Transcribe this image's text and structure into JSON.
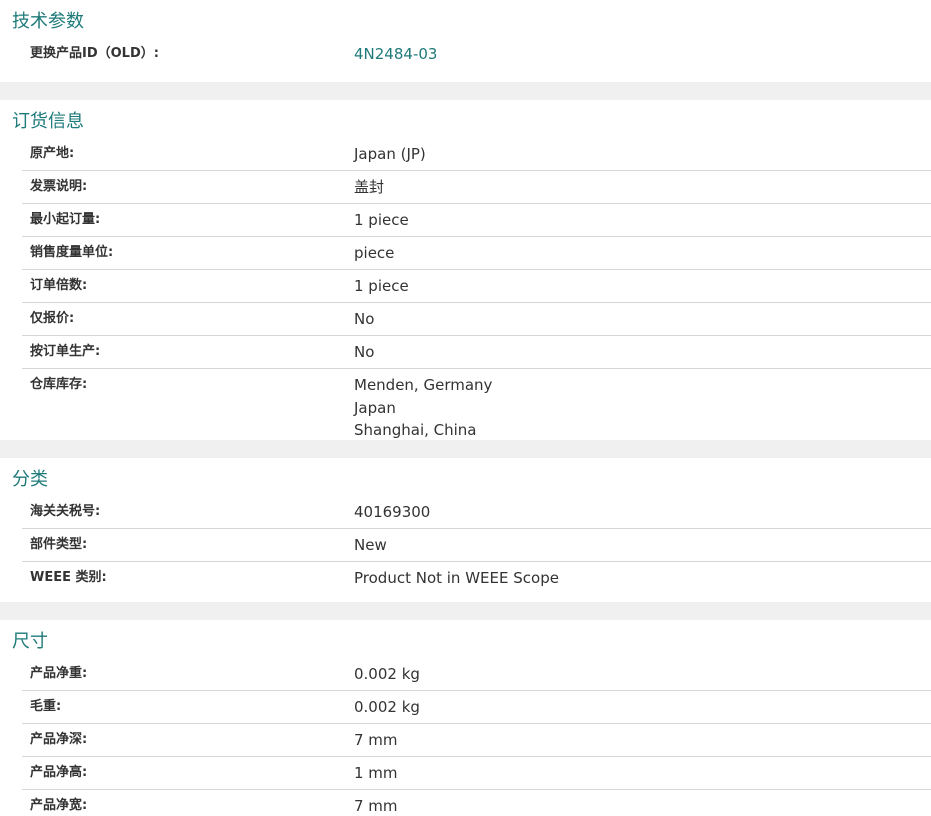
{
  "sections": {
    "tech": {
      "title": "技术参数",
      "rows": [
        {
          "label": "更换产品ID（OLD）:",
          "value": "4N2484-03"
        }
      ]
    },
    "order": {
      "title": "订货信息",
      "rows": [
        {
          "label": "原产地:",
          "value": "Japan (JP)"
        },
        {
          "label": "发票说明:",
          "value": "盖封"
        },
        {
          "label": "最小起订量:",
          "value": "1 piece"
        },
        {
          "label": "销售度量单位:",
          "value": "piece"
        },
        {
          "label": "订单倍数:",
          "value": "1 piece"
        },
        {
          "label": "仅报价:",
          "value": "No"
        },
        {
          "label": "按订单生产:",
          "value": "No"
        },
        {
          "label": "仓库库存:",
          "values": [
            "Menden, Germany",
            "Japan",
            "Shanghai, China"
          ]
        }
      ]
    },
    "classification": {
      "title": "分类",
      "rows": [
        {
          "label": "海关关税号:",
          "value": "40169300"
        },
        {
          "label": "部件类型:",
          "value": "New"
        },
        {
          "label": "WEEE 类别:",
          "value": "Product Not in WEEE Scope"
        }
      ]
    },
    "dimensions": {
      "title": "尺寸",
      "rows": [
        {
          "label": "产品净重:",
          "value": "0.002 kg"
        },
        {
          "label": "毛重:",
          "value": "0.002 kg"
        },
        {
          "label": "产品净深:",
          "value": "7 mm"
        },
        {
          "label": "产品净高:",
          "value": "1 mm"
        },
        {
          "label": "产品净宽:",
          "value": "7 mm"
        }
      ]
    }
  }
}
